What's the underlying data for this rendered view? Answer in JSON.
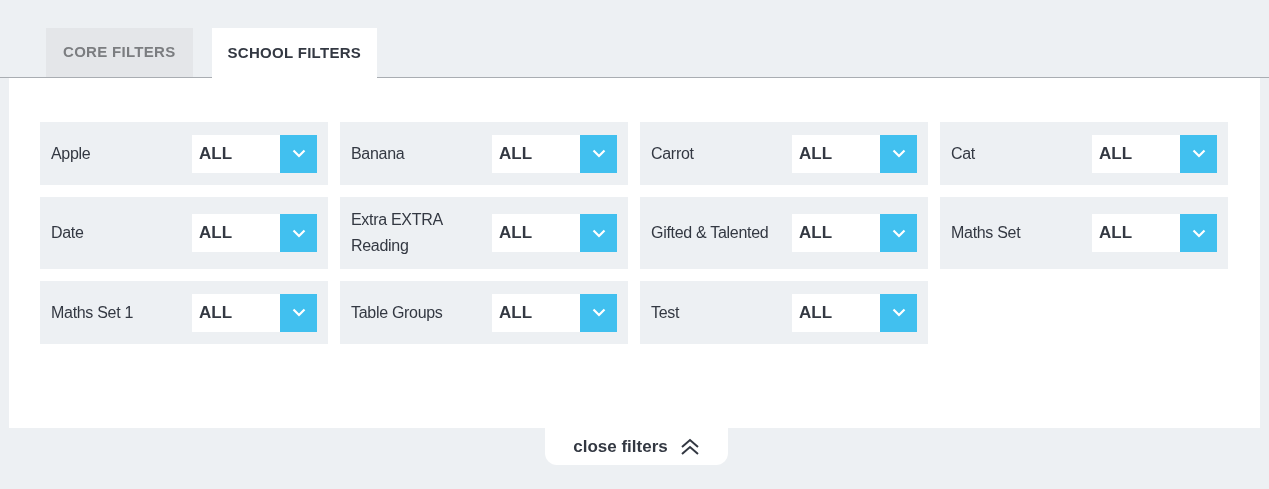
{
  "tabs": [
    {
      "label": "CORE FILTERS",
      "selected": false
    },
    {
      "label": "SCHOOL FILTERS",
      "selected": true
    }
  ],
  "filters": [
    {
      "label": "Apple",
      "value": "ALL"
    },
    {
      "label": "Banana",
      "value": "ALL"
    },
    {
      "label": "Carrot",
      "value": "ALL"
    },
    {
      "label": "Cat",
      "value": "ALL"
    },
    {
      "label": "Date",
      "value": "ALL"
    },
    {
      "label": "Extra EXTRA Reading",
      "value": "ALL"
    },
    {
      "label": "Gifted & Talented",
      "value": "ALL"
    },
    {
      "label": "Maths Set",
      "value": "ALL"
    },
    {
      "label": "Maths Set 1",
      "value": "ALL"
    },
    {
      "label": "Table Groups",
      "value": "ALL"
    },
    {
      "label": "Test",
      "value": "ALL"
    }
  ],
  "close_button": {
    "label": "close filters"
  }
}
